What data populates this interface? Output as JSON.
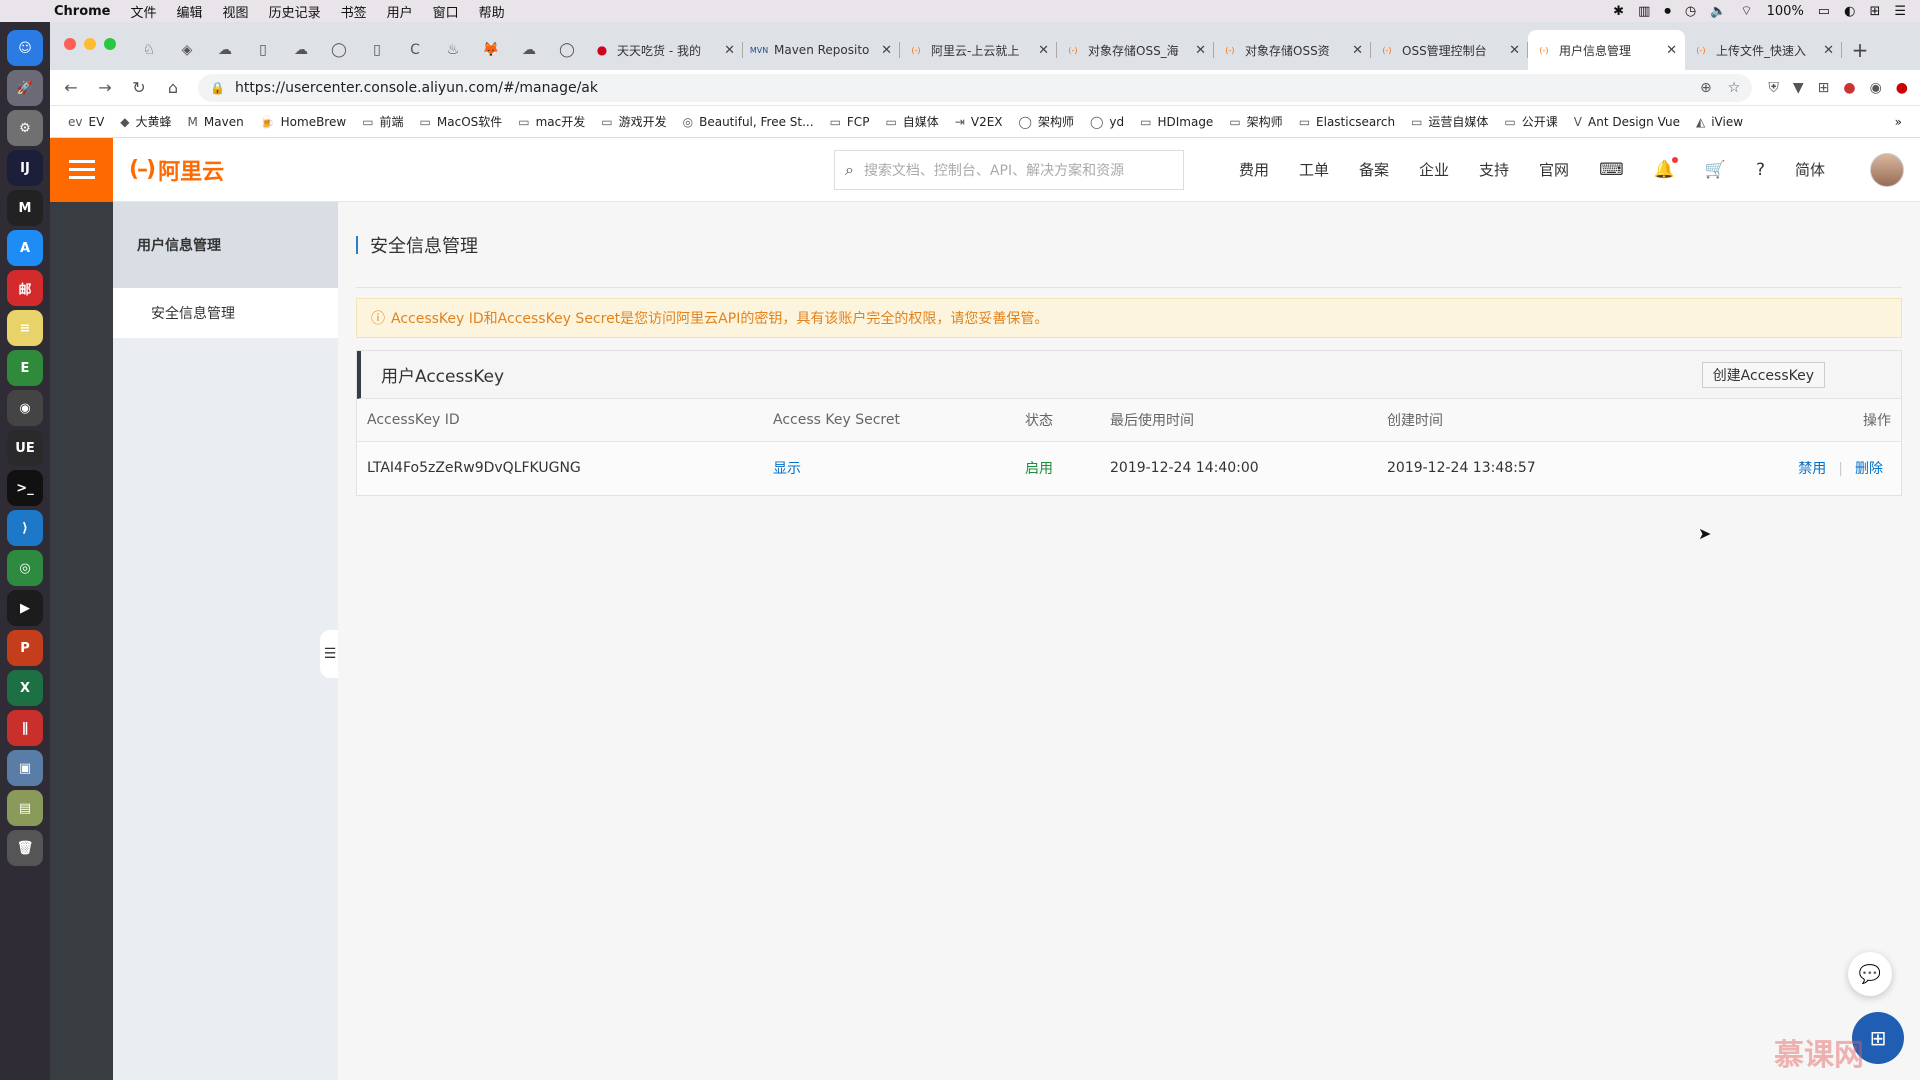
{
  "menubar": {
    "app_name": "Chrome",
    "items": [
      "文件",
      "编辑",
      "视图",
      "历史记录",
      "书签",
      "用户",
      "窗口",
      "帮助"
    ],
    "battery": "100%"
  },
  "dock": {
    "apps": [
      {
        "name": "finder",
        "color": "#2a7be4",
        "label": "☺"
      },
      {
        "name": "launchpad",
        "color": "#6b6b78",
        "label": "🚀"
      },
      {
        "name": "system-preferences",
        "color": "#707070",
        "label": "⚙"
      },
      {
        "name": "intellij",
        "color": "#1b1f3a",
        "label": "IJ"
      },
      {
        "name": "monitor",
        "color": "#222",
        "label": "M"
      },
      {
        "name": "app-store",
        "color": "#1d8cf5",
        "label": "A"
      },
      {
        "name": "mail-163",
        "color": "#d32b2b",
        "label": "邮"
      },
      {
        "name": "stickies",
        "color": "#e8d36a",
        "label": "≡"
      },
      {
        "name": "evernote",
        "color": "#2f8a3b",
        "label": "E"
      },
      {
        "name": "dvd-player",
        "color": "#444",
        "label": "◉"
      },
      {
        "name": "ultraedit",
        "color": "#2a2a2a",
        "label": "UE"
      },
      {
        "name": "terminal",
        "color": "#111",
        "label": ">_"
      },
      {
        "name": "vscode",
        "color": "#1e78c8",
        "label": "⟩"
      },
      {
        "name": "chrome",
        "color": "#2d8a3e",
        "label": "◎"
      },
      {
        "name": "quicktime",
        "color": "#1c1c1c",
        "label": "▶"
      },
      {
        "name": "powerpoint",
        "color": "#c43e1c",
        "label": "P"
      },
      {
        "name": "excel",
        "color": "#1d7044",
        "label": "X"
      },
      {
        "name": "parallels",
        "color": "#c9302c",
        "label": "∥"
      },
      {
        "name": "preview",
        "color": "#5a7da8",
        "label": "▣"
      },
      {
        "name": "archive",
        "color": "#8a9a5b",
        "label": "▤"
      },
      {
        "name": "trash",
        "color": "#555",
        "label": "🗑"
      }
    ]
  },
  "browser": {
    "pinned_tabs": [
      "♘",
      "◈",
      "☁",
      "▯",
      "☁",
      "◯",
      "▯",
      "C",
      "♨",
      "🦊",
      "☁",
      "◯"
    ],
    "tabs": [
      {
        "title": "天天吃货 - 我的",
        "icon": "●",
        "icon_color": "#d0021b",
        "active": false
      },
      {
        "title": "Maven Reposito",
        "icon": "MVN",
        "icon_color": "#1f4b8e",
        "active": false
      },
      {
        "title": "阿里云-上云就上",
        "icon": "(-)",
        "icon_color": "#ff6a00",
        "active": false
      },
      {
        "title": "对象存储OSS_海",
        "icon": "(-)",
        "icon_color": "#ff6a00",
        "active": false
      },
      {
        "title": "对象存储OSS资",
        "icon": "(-)",
        "icon_color": "#ff6a00",
        "active": false
      },
      {
        "title": "OSS管理控制台",
        "icon": "(-)",
        "icon_color": "#ff6a00",
        "active": false
      },
      {
        "title": "用户信息管理",
        "icon": "(-)",
        "icon_color": "#ff6a00",
        "active": true
      },
      {
        "title": "上传文件_快速入",
        "icon": "(-)",
        "icon_color": "#ff6a00",
        "active": false
      }
    ],
    "url": "https://usercenter.console.aliyun.com/#/manage/ak",
    "bookmarks": [
      {
        "label": "EV",
        "icon": "ev"
      },
      {
        "label": "大黄蜂",
        "icon": "◆"
      },
      {
        "label": "Maven",
        "icon": "M"
      },
      {
        "label": "HomeBrew",
        "icon": "🍺"
      },
      {
        "label": "前端",
        "icon": "▭"
      },
      {
        "label": "MacOS软件",
        "icon": "▭"
      },
      {
        "label": "mac开发",
        "icon": "▭"
      },
      {
        "label": "游戏开发",
        "icon": "▭"
      },
      {
        "label": "Beautiful, Free St...",
        "icon": "◎"
      },
      {
        "label": "FCP",
        "icon": "▭"
      },
      {
        "label": "自媒体",
        "icon": "▭"
      },
      {
        "label": "V2EX",
        "icon": "⇥"
      },
      {
        "label": "架构师",
        "icon": "◯"
      },
      {
        "label": "yd",
        "icon": "◯"
      },
      {
        "label": "HDImage",
        "icon": "▭"
      },
      {
        "label": "架构师",
        "icon": "▭"
      },
      {
        "label": "Elasticsearch",
        "icon": "▭"
      },
      {
        "label": "运营自媒体",
        "icon": "▭"
      },
      {
        "label": "公开课",
        "icon": "▭"
      },
      {
        "label": "Ant Design Vue",
        "icon": "V"
      },
      {
        "label": "iView",
        "icon": "◭"
      }
    ],
    "more_bookmarks": "»"
  },
  "console": {
    "logo_text": "阿里云",
    "search_placeholder": "搜索文档、控制台、API、解决方案和资源",
    "nav_links": [
      "费用",
      "工单",
      "备案",
      "企业",
      "支持",
      "官网"
    ],
    "lang": "简体",
    "sidebar": {
      "section_title": "用户信息管理",
      "items": [
        "安全信息管理"
      ]
    },
    "page_title": "安全信息管理",
    "alert_text": "AccessKey ID和AccessKey Secret是您访问阿里云API的密钥，具有该账户完全的权限，请您妥善保管。",
    "panel_title": "用户AccessKey",
    "create_button": "创建AccessKey",
    "table": {
      "columns": [
        "AccessKey ID",
        "Access Key Secret",
        "状态",
        "最后使用时间",
        "创建时间",
        "操作"
      ],
      "rows": [
        {
          "id": "LTAI4Fo5zZeRw9DvQLFKUGNG",
          "secret": "显示",
          "status": "启用",
          "last_used": "2019-12-24 14:40:00",
          "created": "2019-12-24 13:48:57",
          "op_disable": "禁用",
          "op_delete": "删除"
        }
      ]
    },
    "watermark": "慕课网"
  },
  "colors": {
    "brand": "#ff6a00",
    "link": "#0070cc",
    "status_ok": "#1e8e3e",
    "alert_text": "#e2821d"
  }
}
